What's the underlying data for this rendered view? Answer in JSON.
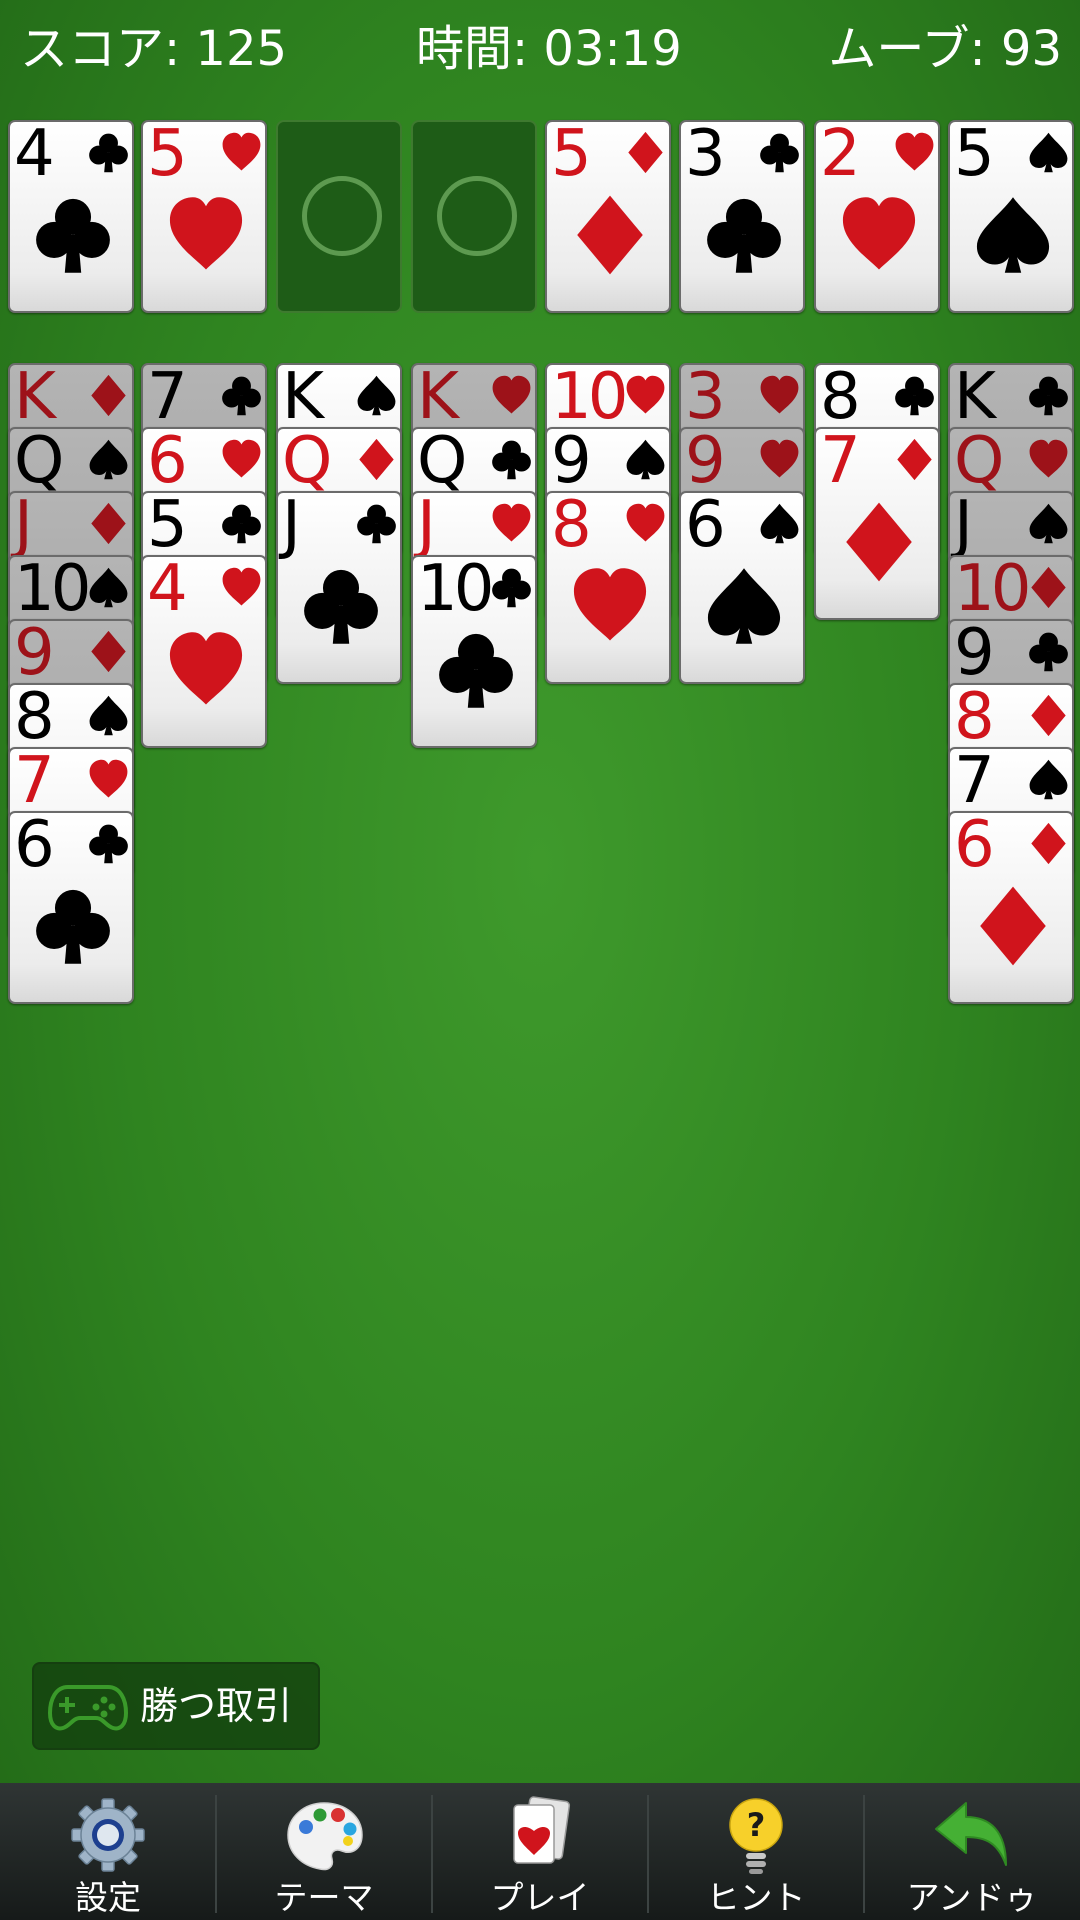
{
  "header": {
    "score": "スコア: 125",
    "time": "時間: 03:19",
    "moves": "ムーブ: 93"
  },
  "free_cells": [
    {
      "rank": "4",
      "suit": "clubs"
    },
    {
      "rank": "5",
      "suit": "hearts"
    },
    null,
    null
  ],
  "foundations": [
    {
      "rank": "5",
      "suit": "diamonds"
    },
    {
      "rank": "3",
      "suit": "clubs"
    },
    {
      "rank": "2",
      "suit": "hearts"
    },
    {
      "rank": "5",
      "suit": "spades"
    }
  ],
  "tableau": [
    [
      {
        "rank": "K",
        "suit": "diamonds",
        "dim": true
      },
      {
        "rank": "Q",
        "suit": "spades",
        "dim": true
      },
      {
        "rank": "J",
        "suit": "diamonds",
        "dim": true
      },
      {
        "rank": "10",
        "suit": "spades",
        "dim": true
      },
      {
        "rank": "9",
        "suit": "diamonds",
        "dim": true
      },
      {
        "rank": "8",
        "suit": "spades",
        "dim": false
      },
      {
        "rank": "7",
        "suit": "hearts",
        "dim": false
      },
      {
        "rank": "6",
        "suit": "clubs",
        "dim": false
      }
    ],
    [
      {
        "rank": "7",
        "suit": "clubs",
        "dim": true
      },
      {
        "rank": "6",
        "suit": "hearts",
        "dim": false
      },
      {
        "rank": "5",
        "suit": "clubs",
        "dim": false
      },
      {
        "rank": "4",
        "suit": "hearts",
        "dim": false
      }
    ],
    [
      {
        "rank": "K",
        "suit": "spades",
        "dim": false
      },
      {
        "rank": "Q",
        "suit": "diamonds",
        "dim": false
      },
      {
        "rank": "J",
        "suit": "clubs",
        "dim": false
      }
    ],
    [
      {
        "rank": "K",
        "suit": "hearts",
        "dim": true
      },
      {
        "rank": "Q",
        "suit": "clubs",
        "dim": false
      },
      {
        "rank": "J",
        "suit": "hearts",
        "dim": false
      },
      {
        "rank": "10",
        "suit": "clubs",
        "dim": false
      }
    ],
    [
      {
        "rank": "10",
        "suit": "hearts",
        "dim": false
      },
      {
        "rank": "9",
        "suit": "spades",
        "dim": false
      },
      {
        "rank": "8",
        "suit": "hearts",
        "dim": false
      }
    ],
    [
      {
        "rank": "3",
        "suit": "hearts",
        "dim": true
      },
      {
        "rank": "9",
        "suit": "hearts",
        "dim": true
      },
      {
        "rank": "6",
        "suit": "spades",
        "dim": false
      }
    ],
    [
      {
        "rank": "8",
        "suit": "clubs",
        "dim": false
      },
      {
        "rank": "7",
        "suit": "diamonds",
        "dim": false
      }
    ],
    [
      {
        "rank": "K",
        "suit": "clubs",
        "dim": true
      },
      {
        "rank": "Q",
        "suit": "hearts",
        "dim": true
      },
      {
        "rank": "J",
        "suit": "spades",
        "dim": true
      },
      {
        "rank": "10",
        "suit": "diamonds",
        "dim": true
      },
      {
        "rank": "9",
        "suit": "clubs",
        "dim": true
      },
      {
        "rank": "8",
        "suit": "diamonds",
        "dim": false
      },
      {
        "rank": "7",
        "suit": "spades",
        "dim": false
      },
      {
        "rank": "6",
        "suit": "diamonds",
        "dim": false
      }
    ]
  ],
  "win_deal_button": {
    "label": "勝つ取引",
    "icon": "gamepad-icon"
  },
  "toolbar": [
    {
      "label": "設定",
      "icon": "gear-icon"
    },
    {
      "label": "テーマ",
      "icon": "palette-icon"
    },
    {
      "label": "プレイ",
      "icon": "cards-icon"
    },
    {
      "label": "ヒント",
      "icon": "lightbulb-icon"
    },
    {
      "label": "アンドゥ",
      "icon": "undo-icon"
    }
  ],
  "colors": {
    "felt": "#2f8420",
    "red_suit": "#d0141c",
    "black_suit": "#000000",
    "toolbar_bg": "#1f2423"
  }
}
